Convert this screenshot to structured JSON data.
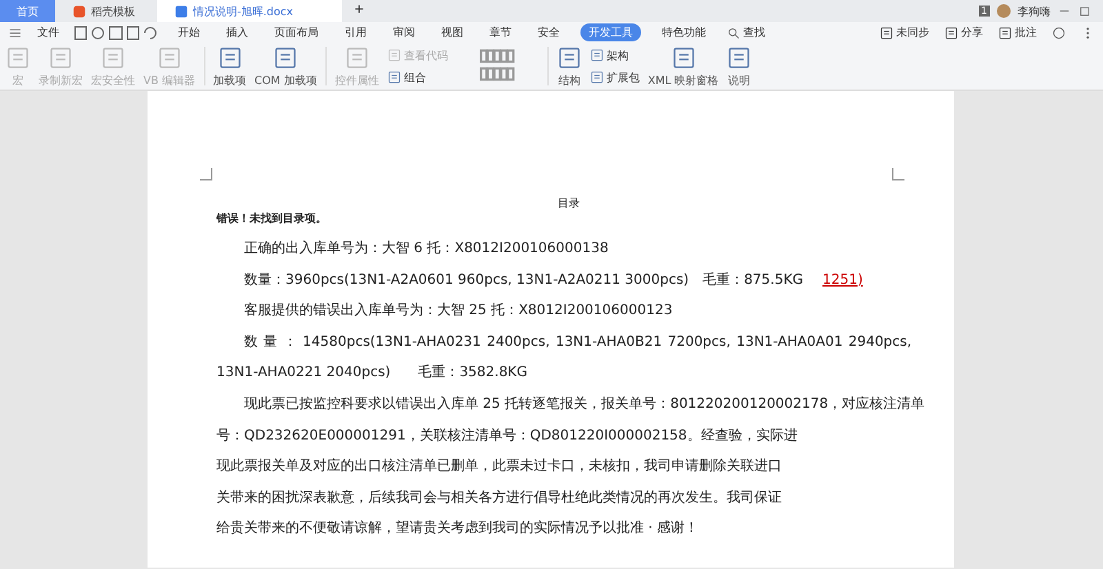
{
  "tabs": [
    {
      "label": "首页",
      "kind": "home",
      "selected": false
    },
    {
      "label": "稻壳模板",
      "kind": "app",
      "selected": false
    },
    {
      "label": "情况说明-旭晖.docx",
      "kind": "doc",
      "selected": true
    }
  ],
  "account": {
    "badge": "1",
    "user": "李狗嗨"
  },
  "menu": {
    "file": "文件",
    "tabs": [
      {
        "label": "开始",
        "selected": false
      },
      {
        "label": "插入",
        "selected": false
      },
      {
        "label": "页面布局",
        "selected": false
      },
      {
        "label": "引用",
        "selected": false
      },
      {
        "label": "审阅",
        "selected": false
      },
      {
        "label": "视图",
        "selected": false
      },
      {
        "label": "章节",
        "selected": false
      },
      {
        "label": "安全",
        "selected": false
      },
      {
        "label": "开发工具",
        "selected": true
      },
      {
        "label": "特色功能",
        "selected": false
      }
    ],
    "search": "查找",
    "actions": [
      "未同步",
      "分享",
      "批注"
    ]
  },
  "ribbon": [
    {
      "label": "宏",
      "disabled": true
    },
    {
      "label": "录制新宏",
      "disabled": true
    },
    {
      "label": "宏安全性",
      "disabled": true
    },
    {
      "label": "VB 编辑器",
      "disabled": true
    },
    {
      "label": "加载项",
      "disabled": false
    },
    {
      "label": "COM 加载项",
      "disabled": false
    },
    {
      "label": "控件属性",
      "disabled": true
    }
  ],
  "ribbon_small": [
    {
      "label": "查看代码",
      "disabled": true
    },
    {
      "label": "组合",
      "disabled": false
    }
  ],
  "ribbon_right": [
    {
      "label": "结构",
      "disabled": false
    }
  ],
  "ribbon_small2": [
    {
      "label": "架构",
      "disabled": false
    },
    {
      "label": "扩展包",
      "disabled": false
    }
  ],
  "ribbon_end": [
    {
      "label": "XML 映射窗格",
      "disabled": false
    },
    {
      "label": "说明",
      "disabled": false
    }
  ],
  "document": {
    "lines": [
      {
        "kind": "heading",
        "text": "目录"
      },
      {
        "kind": "error",
        "text": "错误！未找到目录项。"
      },
      {
        "kind": "indent",
        "text": "正确的出入库单号为：大智 6 托：X8012I200106000138"
      },
      {
        "kind": "indent",
        "text": "数量：3960pcs(13N1-A2A0601 960pcs, 13N1-A2A0211 3000pcs)　毛重：875.5KG",
        "revision": "1251)"
      },
      {
        "kind": "indent",
        "text": "客服提供的错误出入库单号为：大智 25 托：X8012I200106000123"
      },
      {
        "kind": "justified",
        "text": "数 量 ： 14580pcs(13N1-AHA0231 2400pcs, 13N1-AHA0B21 7200pcs, 13N1-AHA0A01 2940pcs,"
      },
      {
        "kind": "plain",
        "text": "13N1-AHA0221 2040pcs)　　毛重：3582.8KG"
      },
      {
        "kind": "indent",
        "text": "现此票已按监控科要求以错误出入库单 25 托转逐笔报关，报关单号：801220200120002178，对应核注清单"
      },
      {
        "kind": "plain",
        "text": "号：QD232620E000001291，关联核注清单号：QD801220I000002158。经查验，实际进"
      },
      {
        "kind": "plain",
        "text": "现此票报关单及对应的出口核注清单已删单，此票未过卡口，未核扣，我司申请删除关联进口"
      },
      {
        "kind": "plain",
        "text": "关带来的困扰深表歉意，后续我司会与相关各方进行倡导杜绝此类情况的再次发生。我司保证"
      },
      {
        "kind": "plain",
        "text": "给贵关带来的不便敬请谅解，望请贵关考虑到我司的实际情况予以批准 · 感谢！"
      }
    ]
  }
}
